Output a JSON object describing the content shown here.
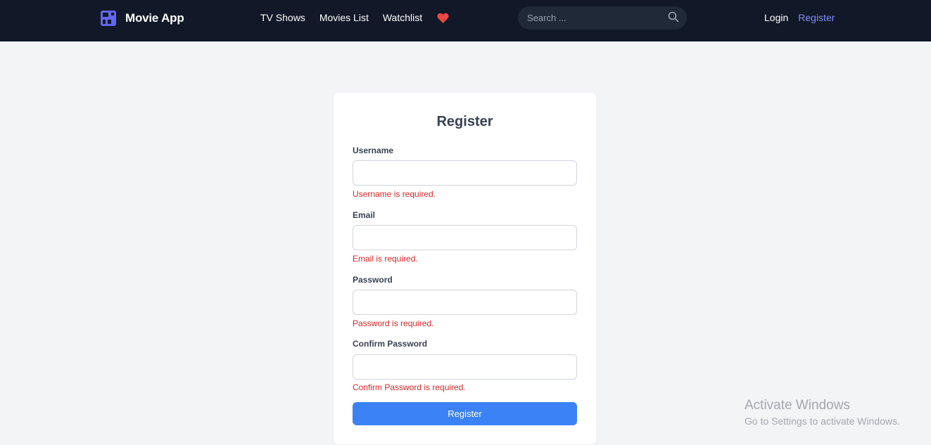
{
  "navbar": {
    "brand_name": "Movie App",
    "links": [
      "TV Shows",
      "Movies List",
      "Watchlist"
    ],
    "search_placeholder": "Search ...",
    "login_label": "Login",
    "register_label": "Register",
    "colors": {
      "background": "#111827",
      "accent": "#818cf8",
      "heart": "#ef4444"
    }
  },
  "form": {
    "title": "Register",
    "fields": [
      {
        "label": "Username",
        "error": "Username is required."
      },
      {
        "label": "Email",
        "error": "Email is required."
      },
      {
        "label": "Password",
        "error": "Password is required."
      },
      {
        "label": "Confirm Password",
        "error": "Confirm Password is required."
      }
    ],
    "submit_label": "Register",
    "colors": {
      "error": "#dc2626",
      "button": "#3b82f6"
    }
  },
  "watermark": {
    "title": "Activate Windows",
    "subtitle": "Go to Settings to activate Windows."
  }
}
